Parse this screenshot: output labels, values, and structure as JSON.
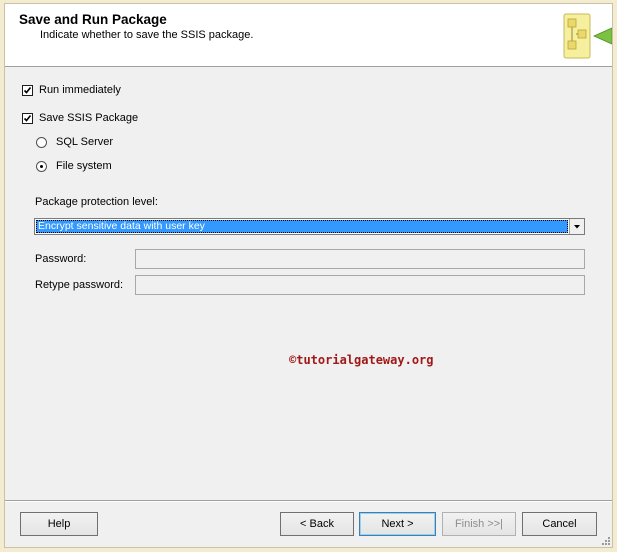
{
  "header": {
    "title": "Save and Run Package",
    "subtitle": "Indicate whether to save the SSIS package."
  },
  "options": {
    "run_immediately": {
      "label": "Run immediately",
      "checked": true
    },
    "save_package": {
      "label": "Save SSIS Package",
      "checked": true
    },
    "sql_server": {
      "label": "SQL Server",
      "selected": false
    },
    "file_system": {
      "label": "File system",
      "selected": true
    }
  },
  "protection": {
    "label": "Package protection level:",
    "value": "Encrypt sensitive data with user key"
  },
  "password": {
    "label": "Password:",
    "value": ""
  },
  "retype_password": {
    "label": "Retype password:",
    "value": ""
  },
  "watermark": "©tutorialgateway.org",
  "buttons": {
    "help": "Help",
    "back": "< Back",
    "next": "Next >",
    "finish": "Finish >>|",
    "cancel": "Cancel"
  },
  "colors": {
    "selection": "#3399ff",
    "watermark": "#a01818",
    "dialog_bg": "#f0f0f0"
  },
  "icons": {
    "header_logo": "ssis-wizard-icon",
    "dropdown": "chevron-down-icon",
    "grip": "resize-grip-icon"
  }
}
